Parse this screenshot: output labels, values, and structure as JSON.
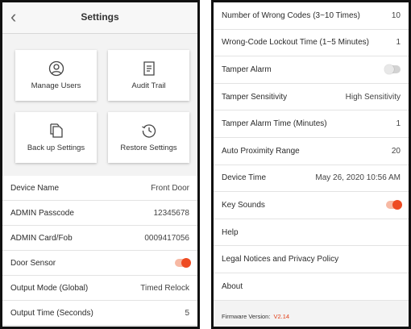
{
  "left": {
    "title": "Settings",
    "tiles": [
      {
        "label": "Manage Users",
        "icon": "user-icon"
      },
      {
        "label": "Audit Trail",
        "icon": "document-icon"
      },
      {
        "label": "Back up Settings",
        "icon": "copy-icon"
      },
      {
        "label": "Restore Settings",
        "icon": "history-icon"
      }
    ],
    "rows": [
      {
        "label": "Device Name",
        "value": "Front Door"
      },
      {
        "label": "ADMIN Passcode",
        "value": "12345678"
      },
      {
        "label": "ADMIN Card/Fob",
        "value": "0009417056"
      },
      {
        "label": "Door Sensor",
        "toggle": "on"
      },
      {
        "label": "Output Mode (Global)",
        "value": "Timed Relock"
      },
      {
        "label": "Output Time (Seconds)",
        "value": "5"
      }
    ]
  },
  "right": {
    "rows": [
      {
        "label": "Number of Wrong Codes (3~10 Times)",
        "value": "10"
      },
      {
        "label": "Wrong-Code Lockout Time (1~5 Minutes)",
        "value": "1"
      },
      {
        "label": "Tamper Alarm",
        "toggle": "off"
      },
      {
        "label": "Tamper Sensitivity",
        "value": "High Sensitivity"
      },
      {
        "label": "Tamper Alarm Time (Minutes)",
        "value": "1"
      },
      {
        "label": "Auto Proximity Range",
        "value": "20"
      },
      {
        "label": "Device Time",
        "value": "May 26, 2020 10:56 AM"
      },
      {
        "label": "Key Sounds",
        "toggle": "on"
      },
      {
        "label": "Help"
      },
      {
        "label": "Legal Notices and Privacy Policy"
      },
      {
        "label": "About"
      }
    ],
    "firmware_label": "Firmware Version:",
    "firmware_value": "V2.14"
  },
  "colors": {
    "accent": "#ee4b22",
    "background": "#f3f3f3",
    "border": "#111111"
  }
}
